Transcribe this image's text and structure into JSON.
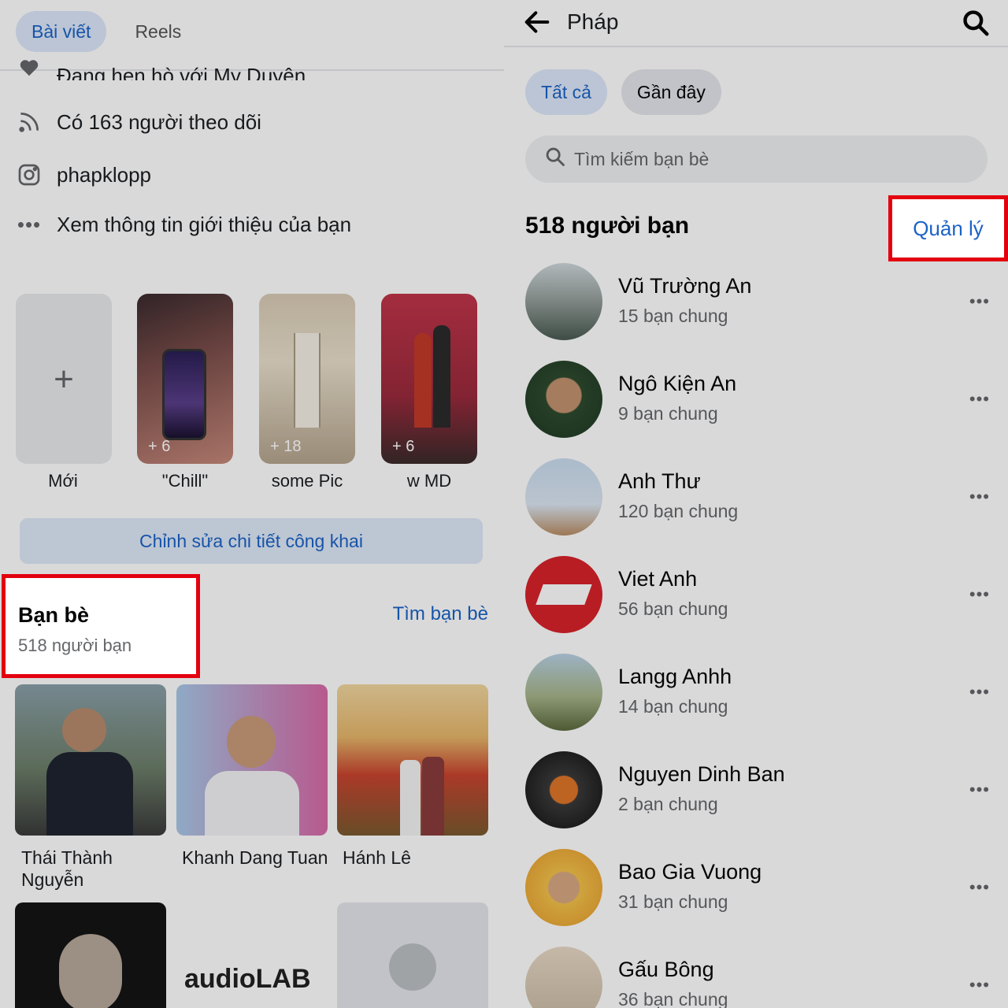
{
  "left": {
    "tabs": [
      "Bài viết",
      "Reels"
    ],
    "partial_row": "Đang hẹn hò với My Duyên",
    "info_rows": [
      {
        "icon": "rss-icon",
        "text": "Có 163 người theo dõi"
      },
      {
        "icon": "instagram-icon",
        "text": "phapklopp"
      },
      {
        "icon": "more-dots-icon",
        "text": "Xem thông tin giới thiệu của bạn"
      }
    ],
    "highlights": [
      {
        "label": "Mới",
        "count": ""
      },
      {
        "label": "\"Chill\"",
        "count": "+ 6"
      },
      {
        "label": "some Pic",
        "count": "+ 18"
      },
      {
        "label": "w MD",
        "count": "+ 6"
      }
    ],
    "edit_button": "Chỉnh sửa chi tiết công khai",
    "friends_title": "Bạn bè",
    "friends_count": "518 người bạn",
    "find_friends": "Tìm bạn bè",
    "friend_tiles": [
      {
        "name": "Thái Thành Nguyễn"
      },
      {
        "name": "Khanh Dang Tuan"
      },
      {
        "name": "Hánh Lê"
      }
    ],
    "audio_logo": "audioLAB"
  },
  "right": {
    "title": "Pháp",
    "filters": [
      "Tất cả",
      "Gần đây"
    ],
    "search_placeholder": "Tìm kiếm bạn bè",
    "count_title": "518 người bạn",
    "manage": "Quản lý",
    "friends": [
      {
        "name": "Vũ Trường An",
        "mutual": "15 bạn chung"
      },
      {
        "name": "Ngô Kiện An",
        "mutual": "9 bạn chung"
      },
      {
        "name": "Anh Thư",
        "mutual": "120 bạn chung"
      },
      {
        "name": "Viet Anh",
        "mutual": "56 bạn chung"
      },
      {
        "name": "Langg Anhh",
        "mutual": "14 bạn chung"
      },
      {
        "name": "Nguyen Dinh Ban",
        "mutual": "2 bạn chung"
      },
      {
        "name": "Bao Gia Vuong",
        "mutual": "31 bạn chung"
      },
      {
        "name": "Gấu Bông",
        "mutual": "36 bạn chung"
      }
    ]
  },
  "colors": {
    "accent": "#1b63c7",
    "highlight_box": "#e3000f"
  }
}
